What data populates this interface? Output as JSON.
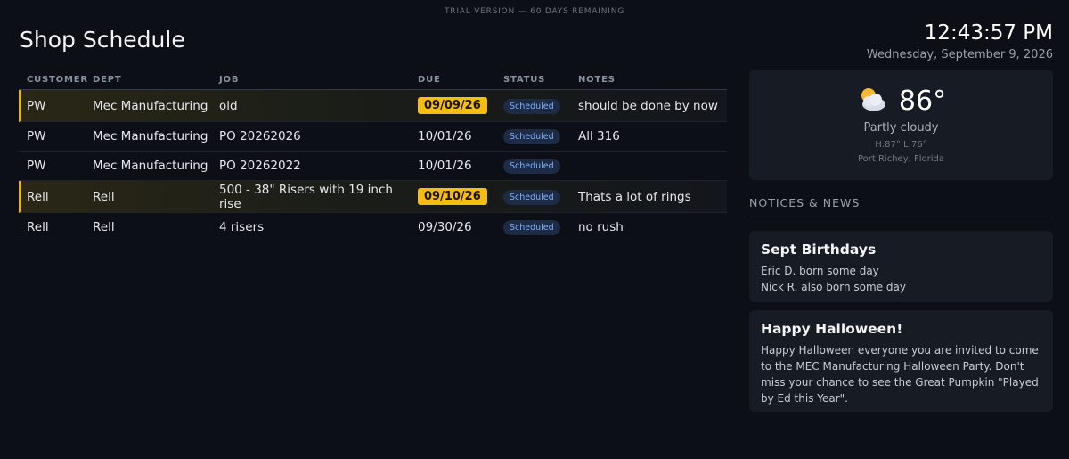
{
  "trial_banner": "TRIAL VERSION — 60 DAYS REMAINING",
  "title": "Shop Schedule",
  "clock": {
    "time": "12:43:57 PM",
    "date": "Wednesday, September 9, 2026"
  },
  "table": {
    "headers": {
      "customer": "CUSTOMER",
      "dept": "DEPT",
      "job": "JOB",
      "due": "DUE",
      "status": "STATUS",
      "notes": "NOTES"
    },
    "rows": [
      {
        "customer": "PW",
        "dept": "Mec Manufacturing",
        "job": "old",
        "due": "09/09/26",
        "status": "Scheduled",
        "notes": "should be done by now"
      },
      {
        "customer": "PW",
        "dept": "Mec Manufacturing",
        "job": "PO 20262026",
        "due": "10/01/26",
        "status": "Scheduled",
        "notes": "All 316"
      },
      {
        "customer": "PW",
        "dept": "Mec Manufacturing",
        "job": "PO 20262022",
        "due": "10/01/26",
        "status": "Scheduled",
        "notes": ""
      },
      {
        "customer": "Rell",
        "dept": "Rell",
        "job": "500 - 38\" Risers with 19 inch rise",
        "due": "09/10/26",
        "status": "Scheduled",
        "notes": "Thats a lot of rings"
      },
      {
        "customer": "Rell",
        "dept": "Rell",
        "job": "4 risers",
        "due": "09/30/26",
        "status": "Scheduled",
        "notes": "no rush"
      }
    ]
  },
  "weather": {
    "icon": "partly-cloudy-icon",
    "temp": "86°",
    "condition": "Partly cloudy",
    "hilo": "H:87° L:76°",
    "location": "Port Richey, Florida"
  },
  "notices": {
    "heading": "NOTICES & NEWS",
    "items": [
      {
        "title": "Sept Birthdays",
        "lines": [
          "Eric D. born some day",
          "Nick R. also born some day"
        ]
      },
      {
        "title": "Happy Halloween!",
        "lines": [
          "Happy Halloween everyone you are invited to come to the MEC Manufacturing Halloween Party. Don't miss your chance to see the Great Pumpkin \"Played by Ed this Year\"."
        ]
      }
    ]
  },
  "colors": {
    "background": "#0c0f16",
    "due_highlight": "#f5bd0f",
    "row_flag_border": "#f0b400",
    "status_badge_bg": "#1d2b45",
    "status_badge_text": "#7fb0ff"
  }
}
